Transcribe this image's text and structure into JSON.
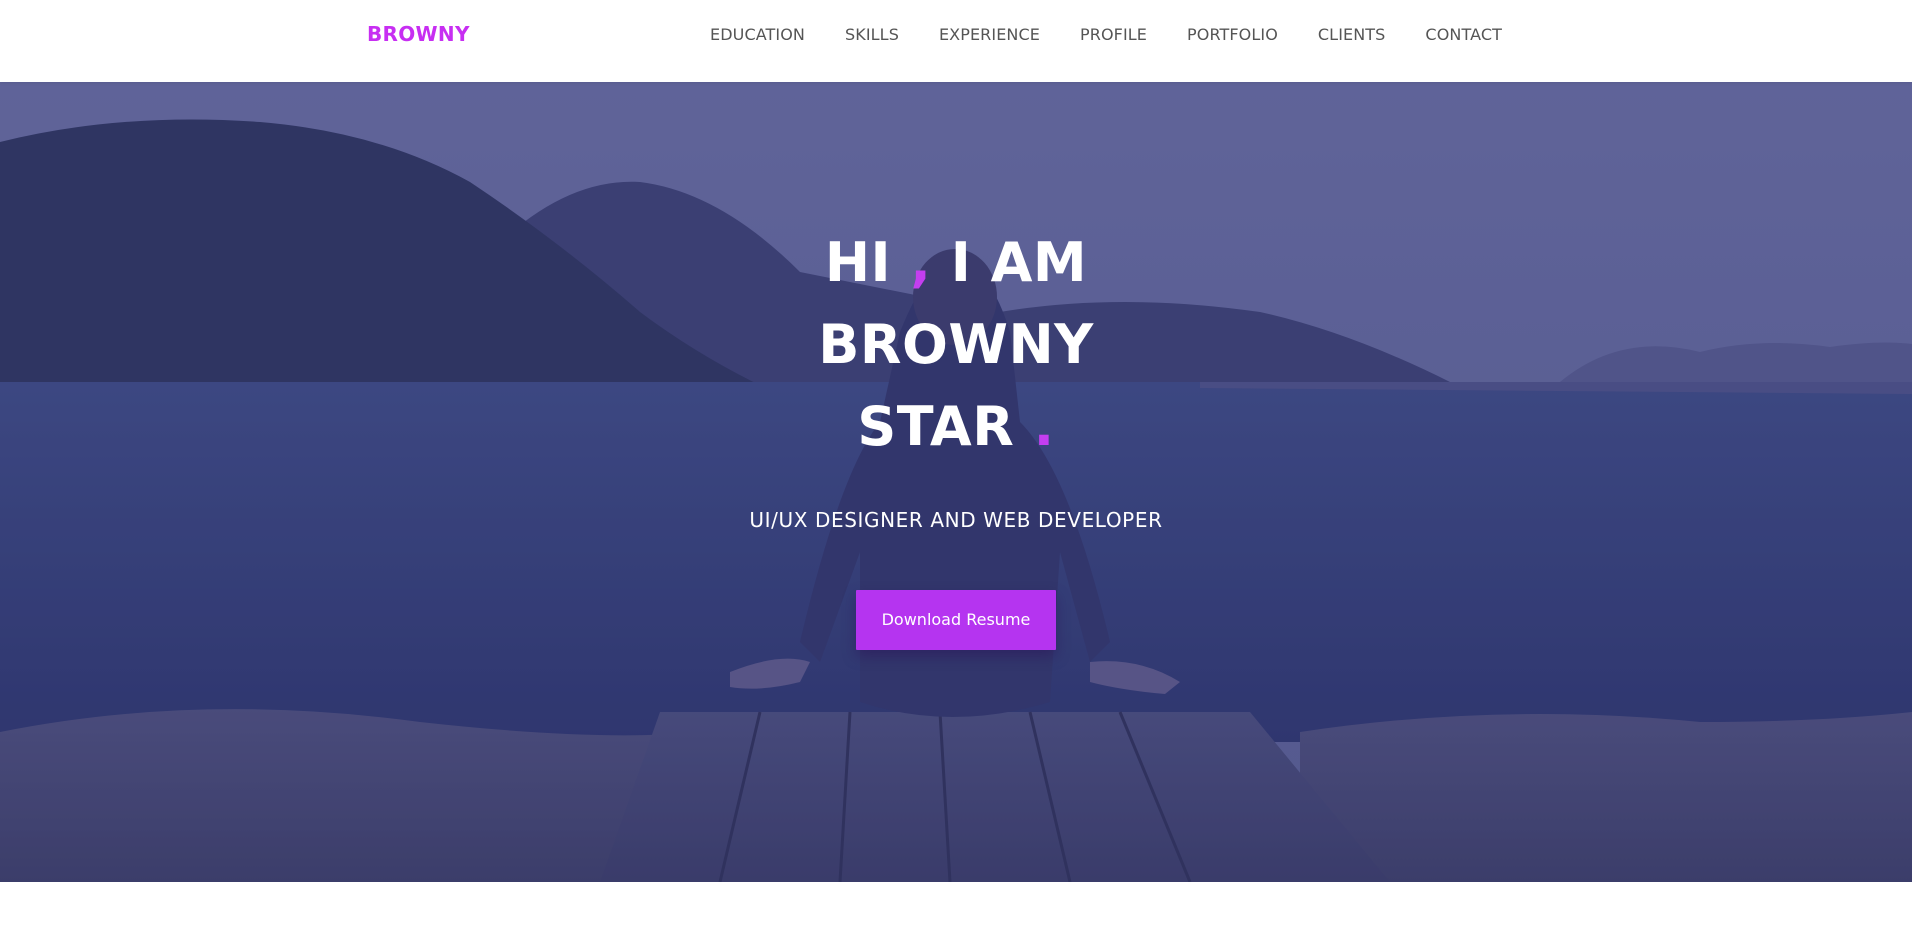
{
  "brand": {
    "name": "BROWNY"
  },
  "nav": {
    "items": [
      {
        "label": "EDUCATION"
      },
      {
        "label": "SKILLS"
      },
      {
        "label": "EXPERIENCE"
      },
      {
        "label": "PROFILE"
      },
      {
        "label": "PORTFOLIO"
      },
      {
        "label": "CLIENTS"
      },
      {
        "label": "CONTACT"
      }
    ]
  },
  "hero": {
    "line1_start": "HI ",
    "line1_comma": ",",
    "line1_end": " I AM",
    "line2": "BROWNY",
    "line3": "STAR ",
    "line3_dot": ".",
    "subtitle": "UI/UX DESIGNER AND WEB DEVELOPER",
    "cta_label": "Download Resume"
  },
  "colors": {
    "accent": "#c43ef0",
    "button": "#b534f0",
    "overlay": "#3b3f88",
    "nav_text": "#555555",
    "brand": "#c72ef2"
  }
}
